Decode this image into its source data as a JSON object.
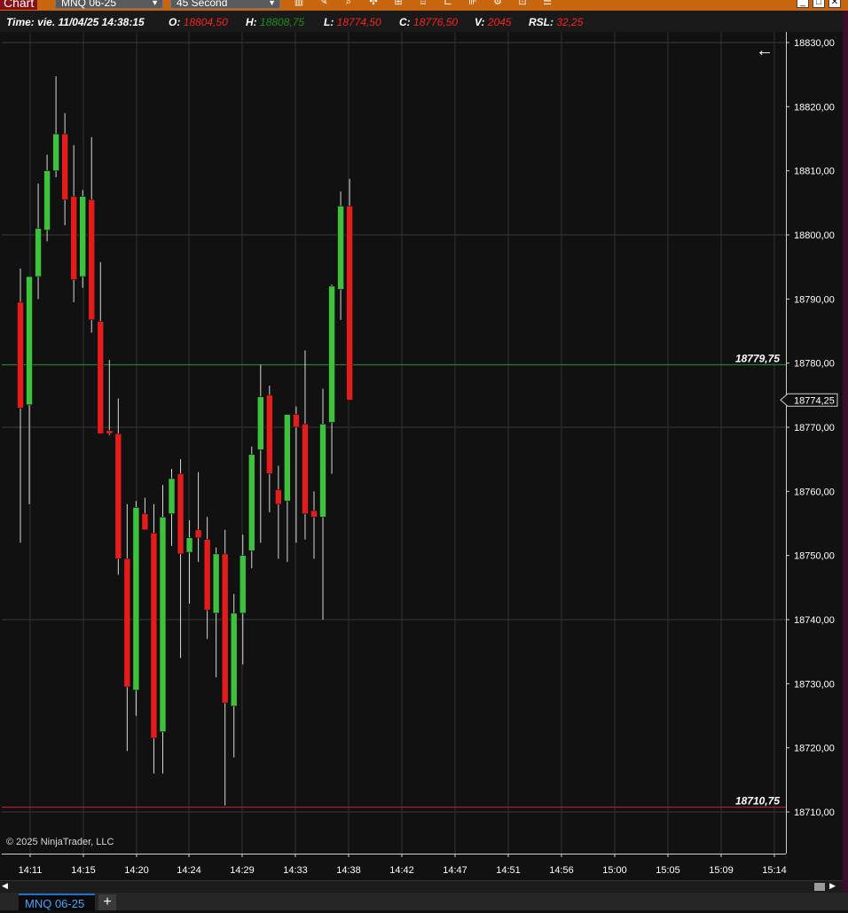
{
  "window": {
    "title": "Chart",
    "instrument_select": "MNQ 06-25",
    "period_select": "45 Second",
    "toolbar_icons": [
      "bar-type-icon",
      "draw-tool-icon",
      "zoom-icon",
      "crosshair-icon",
      "data-box-icon",
      "indicator-icon",
      "strategy-icon",
      "chart-trader-icon",
      "properties-icon",
      "templates-icon",
      "list-icon"
    ],
    "window_buttons": [
      "minimize",
      "maximize",
      "close"
    ]
  },
  "databox": {
    "time_label": "Time:",
    "time_value": "vie. 11/04/25 14:38:15",
    "open_label": "O:",
    "open_value": "18804,50",
    "high_label": "H:",
    "high_value": "18808,75",
    "low_label": "L:",
    "low_value": "18774,50",
    "close_label": "C:",
    "close_value": "18776,50",
    "volume_label": "V:",
    "volume_value": "2045",
    "rsl_label": "RSL:",
    "rsl_value": "32,25"
  },
  "colors": {
    "background": "#111111",
    "up_candle": "#3ec23e",
    "down_candle": "#e51c1c",
    "green_line": "#2e7d2e",
    "red_line": "#c0182b",
    "value_green": "#1f8f1f",
    "value_red": "#ff2020",
    "text": "#ffffff"
  },
  "copyright": "© 2025 NinjaTrader, LLC",
  "tab": {
    "label": "MNQ 06-25",
    "add_label": "+"
  },
  "chart_data": {
    "type": "candlestick",
    "instrument": "MNQ 06-25",
    "bar_period": "45 Second",
    "ylim": [
      18702,
      18834
    ],
    "y_ticks": [
      "18830,00",
      "18820,00",
      "18810,00",
      "18800,00",
      "18790,00",
      "18780,00",
      "18770,00",
      "18760,00",
      "18750,00",
      "18740,00",
      "18730,00",
      "18720,00",
      "18710,00"
    ],
    "y_tick_values": [
      18830,
      18820,
      18810,
      18800,
      18790,
      18780,
      18770,
      18760,
      18750,
      18740,
      18730,
      18720,
      18710
    ],
    "x_ticks": [
      "14:11",
      "14:15",
      "14:20",
      "14:24",
      "14:29",
      "14:33",
      "14:38",
      "14:42",
      "14:47",
      "14:51",
      "14:56",
      "15:00",
      "15:05",
      "15:09",
      "15:14"
    ],
    "horizontal_lines": [
      {
        "value": 18779.75,
        "label": "18779,75",
        "color": "green"
      },
      {
        "value": 18710.75,
        "label": "18710,75",
        "color": "red"
      }
    ],
    "current_price_label": "18774,25",
    "current_price": 18774.25,
    "candles": [
      {
        "o": 18789.5,
        "h": 18794.75,
        "l": 18752.0,
        "c": 18773.0
      },
      {
        "o": 18773.5,
        "h": 18786.25,
        "l": 18758.0,
        "c": 18793.5
      },
      {
        "o": 18793.5,
        "h": 18808.0,
        "l": 18790.0,
        "c": 18801.0
      },
      {
        "o": 18800.75,
        "h": 18812.5,
        "l": 18799.0,
        "c": 18810.0
      },
      {
        "o": 18810.0,
        "h": 18824.75,
        "l": 18809.0,
        "c": 18815.75
      },
      {
        "o": 18815.75,
        "h": 18819.0,
        "l": 18801.5,
        "c": 18805.5
      },
      {
        "o": 18806.0,
        "h": 18814.0,
        "l": 18789.5,
        "c": 18793.0
      },
      {
        "o": 18793.5,
        "h": 18807.0,
        "l": 18791.75,
        "c": 18806.0
      },
      {
        "o": 18805.5,
        "h": 18815.25,
        "l": 18784.75,
        "c": 18786.75
      },
      {
        "o": 18786.5,
        "h": 18795.75,
        "l": 18769.25,
        "c": 18769.0
      },
      {
        "o": 18769.5,
        "h": 18780.5,
        "l": 18768.75,
        "c": 18769.0
      },
      {
        "o": 18769.0,
        "h": 18774.5,
        "l": 18747.0,
        "c": 18749.5
      },
      {
        "o": 18749.5,
        "h": 18758.0,
        "l": 18719.5,
        "c": 18729.5
      },
      {
        "o": 18729.0,
        "h": 18758.5,
        "l": 18725.0,
        "c": 18757.5
      },
      {
        "o": 18756.5,
        "h": 18759.0,
        "l": 18754.0,
        "c": 18754.0
      },
      {
        "o": 18753.5,
        "h": 18758.0,
        "l": 18716.0,
        "c": 18721.5
      },
      {
        "o": 18722.5,
        "h": 18761.0,
        "l": 18716.0,
        "c": 18756.0
      },
      {
        "o": 18756.5,
        "h": 18763.5,
        "l": 18751.5,
        "c": 18762.0
      },
      {
        "o": 18762.75,
        "h": 18765.0,
        "l": 18734.0,
        "c": 18750.25
      },
      {
        "o": 18750.5,
        "h": 18755.5,
        "l": 18742.5,
        "c": 18752.75
      },
      {
        "o": 18754.0,
        "h": 18763.0,
        "l": 18749.0,
        "c": 18752.75
      },
      {
        "o": 18752.5,
        "h": 18756.0,
        "l": 18737.0,
        "c": 18741.5
      },
      {
        "o": 18741.0,
        "h": 18751.25,
        "l": 18731.0,
        "c": 18750.25
      },
      {
        "o": 18750.25,
        "h": 18754.0,
        "l": 18711.0,
        "c": 18727.0
      },
      {
        "o": 18726.5,
        "h": 18744.0,
        "l": 18718.5,
        "c": 18741.0
      },
      {
        "o": 18741.0,
        "h": 18753.25,
        "l": 18733.0,
        "c": 18750.0
      },
      {
        "o": 18750.75,
        "h": 18767.0,
        "l": 18748.0,
        "c": 18765.75
      },
      {
        "o": 18766.5,
        "h": 18779.75,
        "l": 18752.0,
        "c": 18774.75
      },
      {
        "o": 18775.0,
        "h": 18776.5,
        "l": 18756.75,
        "c": 18762.75
      },
      {
        "o": 18760.25,
        "h": 18764.0,
        "l": 18749.5,
        "c": 18758.0
      },
      {
        "o": 18758.5,
        "h": 18772.0,
        "l": 18749.0,
        "c": 18772.0
      },
      {
        "o": 18772.0,
        "h": 18773.25,
        "l": 18752.0,
        "c": 18770.0
      },
      {
        "o": 18770.5,
        "h": 18782.0,
        "l": 18752.5,
        "c": 18756.5
      },
      {
        "o": 18757.0,
        "h": 18760.0,
        "l": 18749.5,
        "c": 18756.0
      },
      {
        "o": 18756.0,
        "h": 18776.0,
        "l": 18740.0,
        "c": 18770.5
      },
      {
        "o": 18770.75,
        "h": 18792.25,
        "l": 18762.75,
        "c": 18792.0
      },
      {
        "o": 18791.5,
        "h": 18806.75,
        "l": 18786.75,
        "c": 18804.5
      },
      {
        "o": 18804.5,
        "h": 18808.75,
        "l": 18774.5,
        "c": 18774.25
      }
    ]
  }
}
